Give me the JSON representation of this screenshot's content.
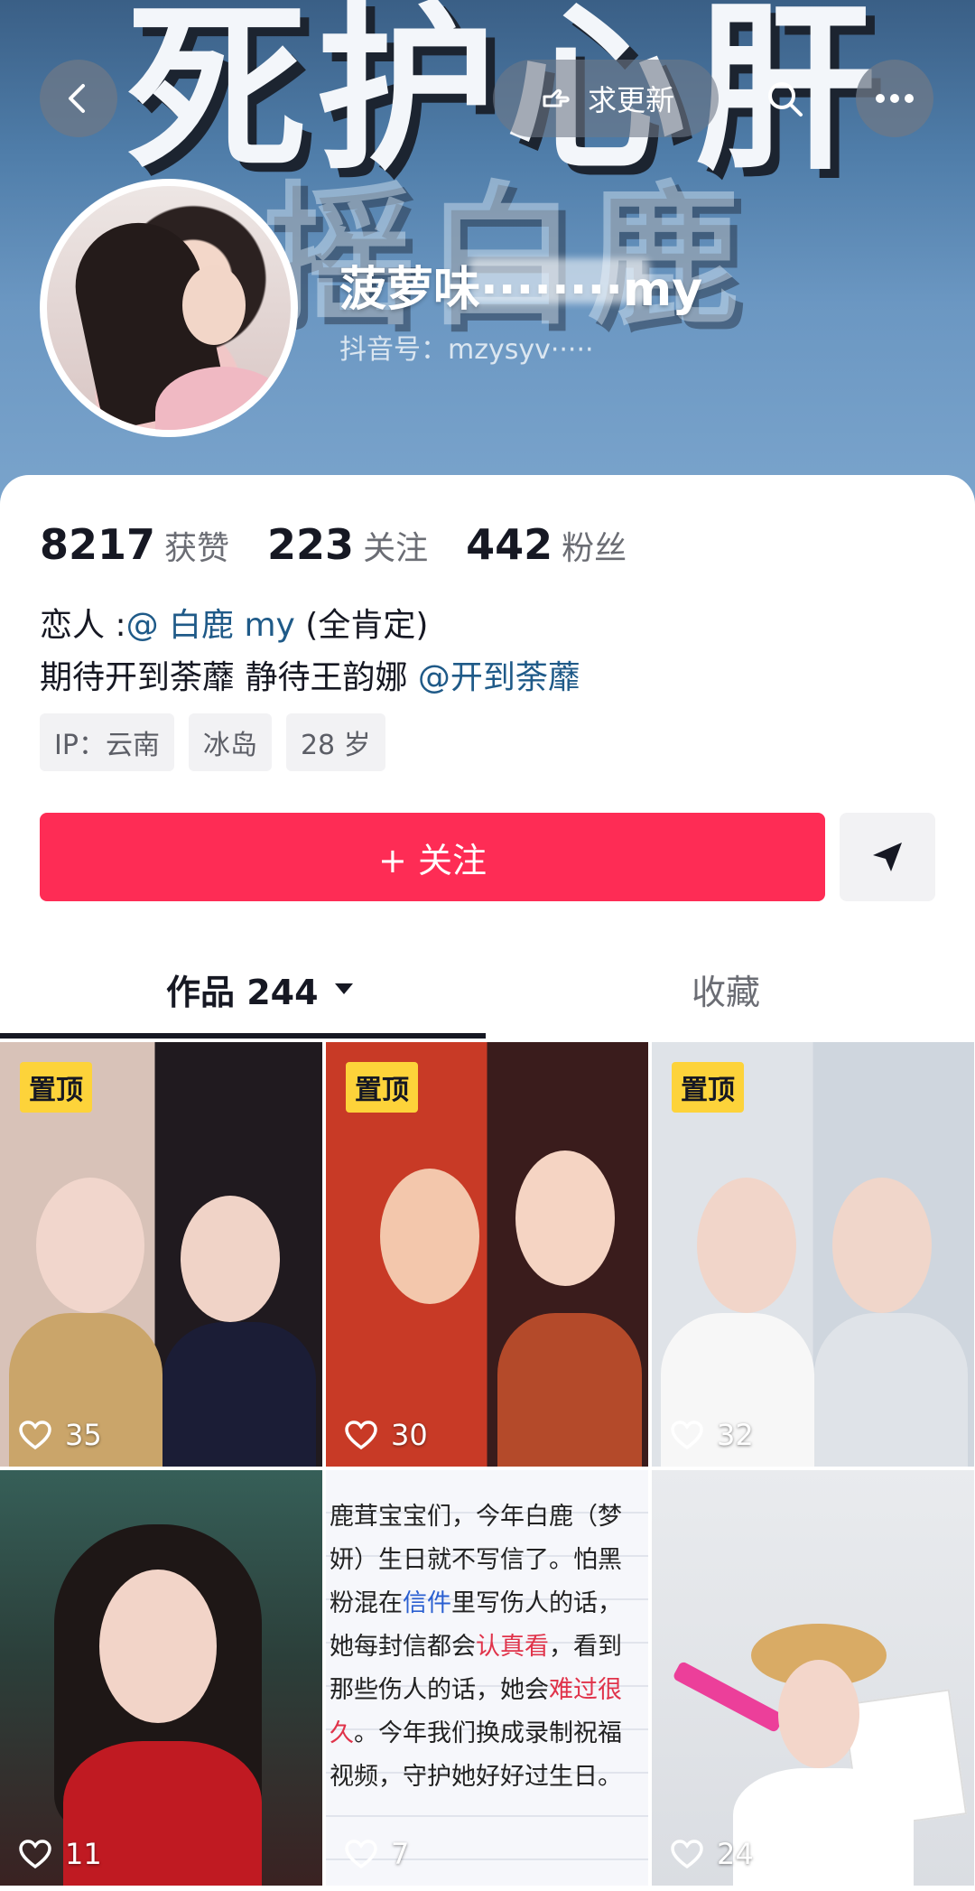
{
  "header": {
    "banner_line1": "死护心肝",
    "banner_line2": "摇白鹿",
    "request_update_label": "求更新",
    "nickname": "菠萝味········my",
    "douyin_id": "抖音号：mzysyv·····"
  },
  "icons": {
    "back": "back-arrow-icon",
    "request_update": "heart-hand-icon",
    "search": "search-icon",
    "more": "more-dots-icon",
    "share": "send-icon",
    "like": "heart-icon",
    "dropdown": "triangle-down-icon"
  },
  "stats": [
    {
      "value": "8217",
      "label": "获赞"
    },
    {
      "value": "223",
      "label": "关注"
    },
    {
      "value": "442",
      "label": "粉丝"
    }
  ],
  "bio": {
    "line1_prefix": "恋人 :",
    "line1_mention": "@ 白鹿 my",
    "line1_suffix": " (全肯定)",
    "line2_prefix": "期待开到荼蘼 静待王韵娜 ",
    "line2_mention": "@开到荼蘼"
  },
  "tags": [
    "IP：云南",
    "冰岛",
    "28 岁"
  ],
  "follow_button": "+ 关注",
  "tabs": {
    "works": "作品 244",
    "favorites": "收藏"
  },
  "pin_label": "置顶",
  "videos": [
    {
      "likes": "35",
      "pinned": true
    },
    {
      "likes": "30",
      "pinned": true
    },
    {
      "likes": "32",
      "pinned": true
    },
    {
      "likes": "11",
      "pinned": false
    },
    {
      "likes": "7",
      "pinned": false
    },
    {
      "likes": "24",
      "pinned": false
    }
  ],
  "note_video_text": {
    "l1a": "鹿茸宝宝们，今年白鹿（",
    "l1b": "梦",
    "l2a": "妍）生日就不写信了。怕黑",
    "l3a": "粉混在",
    "l3b": "信件",
    "l3c": "里写伤人的话，",
    "l4a": "她每封信都会",
    "l4b": "认真看",
    "l4c": "，看到",
    "l5a": "那些伤人的话，她会",
    "l5b": "难过很",
    "l6a": "久",
    "l6b": "。今年我们换成录制祝福",
    "l7a": "视频，守护她好好过生日。"
  },
  "colors": {
    "accent_red": "#fe2c55",
    "mention_blue": "#1f5a88",
    "pin_yellow": "#fdd33a"
  }
}
